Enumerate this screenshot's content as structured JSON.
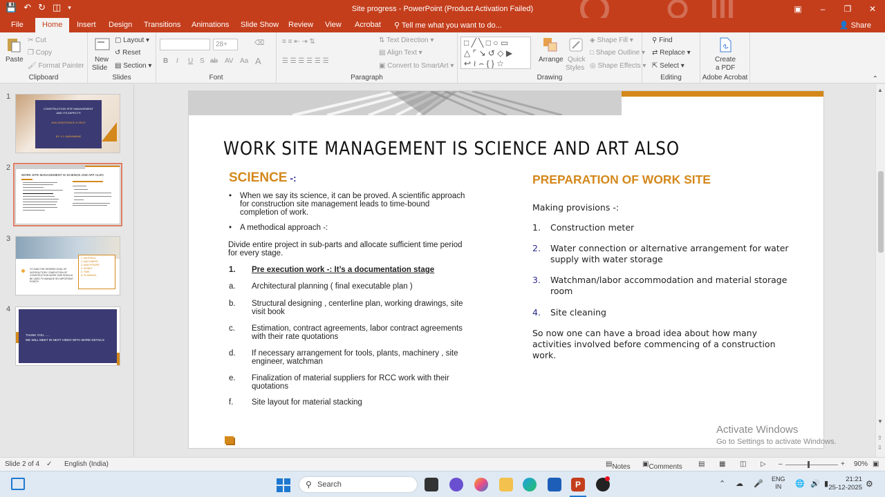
{
  "window": {
    "title": "Site progress - PowerPoint (Product Activation Failed)"
  },
  "tabs": [
    "File",
    "Home",
    "Insert",
    "Design",
    "Transitions",
    "Animations",
    "Slide Show",
    "Review",
    "View",
    "Acrobat"
  ],
  "tell_me": "Tell me what you want to do...",
  "share": "Share",
  "ribbon": {
    "clipboard": {
      "paste": "Paste",
      "cut": "Cut",
      "copy": "Copy",
      "format_painter": "Format Painter",
      "label": "Clipboard"
    },
    "slides": {
      "new_slide": "New",
      "new_slide2": "Slide",
      "layout": "Layout",
      "reset": "Reset",
      "section": "Section",
      "label": "Slides"
    },
    "font": {
      "size": "28+",
      "label": "Font",
      "b": "B",
      "i": "I",
      "u": "U",
      "s": "S",
      "ab": "ab",
      "av": "AV",
      "aa": "Aa"
    },
    "paragraph": {
      "text_direction": "Text Direction",
      "align_text": "Align Text",
      "smartart": "Convert to SmartArt",
      "label": "Paragraph"
    },
    "drawing": {
      "arrange": "Arrange",
      "quick_styles": "Quick",
      "quick_styles2": "Styles",
      "shape_fill": "Shape Fill",
      "shape_outline": "Shape Outline",
      "shape_effects": "Shape Effects",
      "label": "Drawing"
    },
    "editing": {
      "find": "Find",
      "replace": "Replace",
      "select": "Select",
      "label": "Editing"
    },
    "acrobat": {
      "create": "Create",
      "create2": "a PDF",
      "label": "Adobe Acrobat"
    }
  },
  "thumbnails": [
    {
      "num": "1",
      "line1": "CONSTRUCTION SITE MANAGEMENT",
      "line2": "AND ITS ASPECTS",
      "line3": "ASK ASSISTANCE & HELP",
      "line4": "BY V.Y. BARAMBHE"
    },
    {
      "num": "2",
      "title": "WORK SITE MANAGEMENT IS SCIENCE AND ART ALSO"
    },
    {
      "num": "3",
      "list": [
        "1. MATERIAL",
        "2. MACHINERY",
        "3. MAN POWER",
        "4. MONEY",
        "5. TIME",
        "6. PLANNING"
      ],
      "text": "TO GAIN THE DESIRED GOAL OF SATISFACTORY COMPLETION OF CONSTRUCTION WORK ONE SHOULD BE USED TO MANAGE SIX IMPORTANT POINTS"
    },
    {
      "num": "4",
      "line1": "THANK YOU.......",
      "line2": "WE WILL MEET IN NEXT VIDEO WITH MORE DETAILS"
    }
  ],
  "slide": {
    "title": "WORK SITE MANAGEMENT IS SCIENCE AND ART ALSO",
    "science_heading": "SCIENCE",
    "science_suffix": " -:",
    "bullet1_line1": "When we say its science, it can be proved. A scientific approach",
    "bullet1_line2": "for construction site management leads to time-bound",
    "bullet1_line3": "completion of work.",
    "bullet2": "A methodical approach -:",
    "divide_line1": "Divide entire project in sub-parts and allocate sufficient time period",
    "divide_line2": "for every stage.",
    "pre_exec_num": "1.",
    "pre_exec": "Pre execution work -: It’s a documentation stage",
    "items": [
      {
        "letter": "a.",
        "l1": "Architectural planning ( final executable plan )",
        "l2": ""
      },
      {
        "letter": "b.",
        "l1": "Structural designing , centerline plan, working drawings, site",
        "l2": "visit book"
      },
      {
        "letter": "c.",
        "l1": "Estimation, contract agreements, labor contract agreements",
        "l2": "with their rate quotations"
      },
      {
        "letter": "d.",
        "l1": "If necessary arrangement for tools, plants, machinery , site",
        "l2": "engineer, watchman"
      },
      {
        "letter": "e.",
        "l1": "Finalization of material suppliers for RCC work with their",
        "l2": "quotations"
      },
      {
        "letter": "f.",
        "l1": "Site layout for material stacking",
        "l2": ""
      }
    ],
    "prep_heading": "PREPARATION OF WORK SITE",
    "making": "Making provisions -:",
    "provisions": [
      {
        "num": "1.",
        "l1": "Construction meter",
        "l2": ""
      },
      {
        "num": "2.",
        "l1": "Water connection or alternative arrangement for water",
        "l2": "supply with water storage"
      },
      {
        "num": "3.",
        "l1": "Watchman/labor accommodation and material storage",
        "l2": "room"
      },
      {
        "num": "4.",
        "l1": "Site cleaning",
        "l2": ""
      }
    ],
    "sonow_l1": "So now one can have a broad idea about how many",
    "sonow_l2": "activities involved before commencing of a construction",
    "sonow_l3": "work."
  },
  "watermark": {
    "line1": "Activate Windows",
    "line2": "Go to Settings to activate Windows."
  },
  "status": {
    "slide": "Slide 2 of 4",
    "language": "English (India)",
    "notes": "Notes",
    "comments": "Comments",
    "zoom": "90%"
  },
  "taskbar": {
    "search": "Search",
    "lang1": "ENG",
    "lang2": "IN",
    "time": "21:21",
    "date": "25-12-2025"
  },
  "colors": {
    "accent": "#c43e1c",
    "orange": "#d4881b",
    "navy": "#3b3a72"
  }
}
